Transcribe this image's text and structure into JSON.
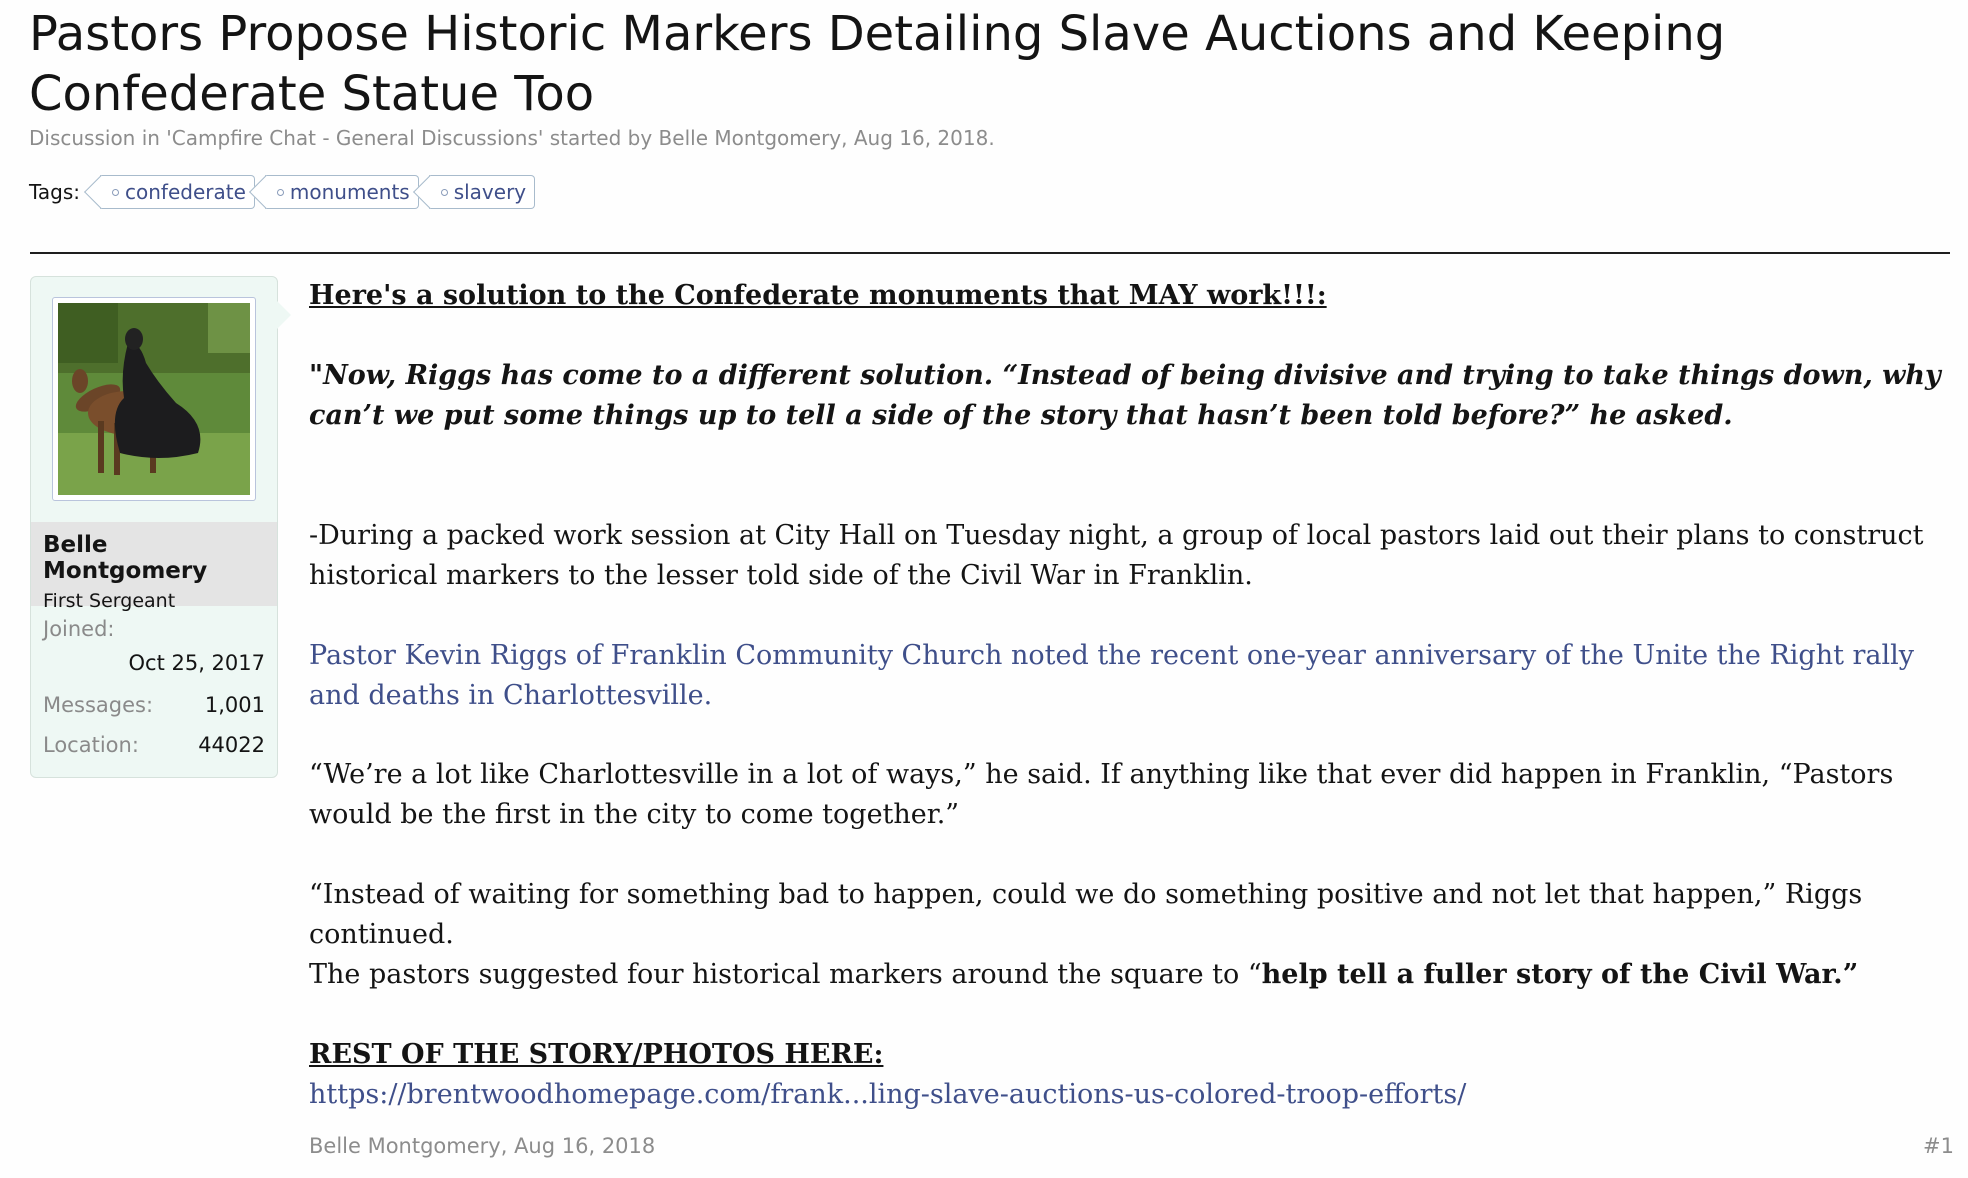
{
  "thread": {
    "title": "Pastors Propose Historic Markers Detailing Slave Auctions and Keeping Confederate Statue Too",
    "meta": "Discussion in 'Campfire Chat - General Discussions' started by Belle Montgomery, Aug 16, 2018.",
    "tags_label": "Tags:",
    "tags": [
      "confederate",
      "monuments",
      "slavery"
    ]
  },
  "user": {
    "name": "Belle Montgomery",
    "title": "First Sergeant",
    "avatar_icon": "avatar-rider-on-horse",
    "joined_label": "Joined:",
    "joined_value": "Oct 25, 2017",
    "messages_label": "Messages:",
    "messages_value": "1,001",
    "location_label": "Location:",
    "location_value": "44022"
  },
  "post": {
    "heading": "Here's a solution to the Confederate monuments that MAY work!!!:",
    "quote": "\"Now, Riggs has come to a different solution. “Instead of being divisive and trying to take things down, why can’t we put some things up to tell a side of the story that hasn’t been told before?” he asked.",
    "intro": "-During a packed work session at City Hall on Tuesday night, a group of local pastors laid out their plans to construct historical markers to the lesser told side of the Civil War in Franklin.",
    "blue_paragraph": "Pastor Kevin Riggs of Franklin Community Church noted the recent one-year anniversary of the Unite the Right rally and deaths in Charlottesville.",
    "quote2": "“We’re a lot like Charlottesville in a lot of ways,” he said. If anything like that ever did happen in Franklin, “Pastors would be the first in the city to come together.”",
    "instead": "“Instead of waiting for something bad to happen, could we do something positive and not let that happen,” Riggs continued.",
    "pastors_prefix": "The pastors suggested four historical markers around the square to “",
    "pastors_bold": "help tell a fuller story of the Civil War.”",
    "rest_label": "REST OF THE STORY/PHOTOS HERE",
    "rest_colon": ":",
    "link_text": "https://brentwoodhomepage.com/frank...ling-slave-auctions-us-colored-troop-efforts/"
  },
  "footer": {
    "author": "Belle Montgomery",
    "date": ", Aug 16, 2018",
    "post_number": "#1"
  },
  "colors": {
    "link_blue": "#3f4f8a",
    "user_card_bg": "#eef8f4",
    "meta_gray": "#8c8c8c"
  }
}
